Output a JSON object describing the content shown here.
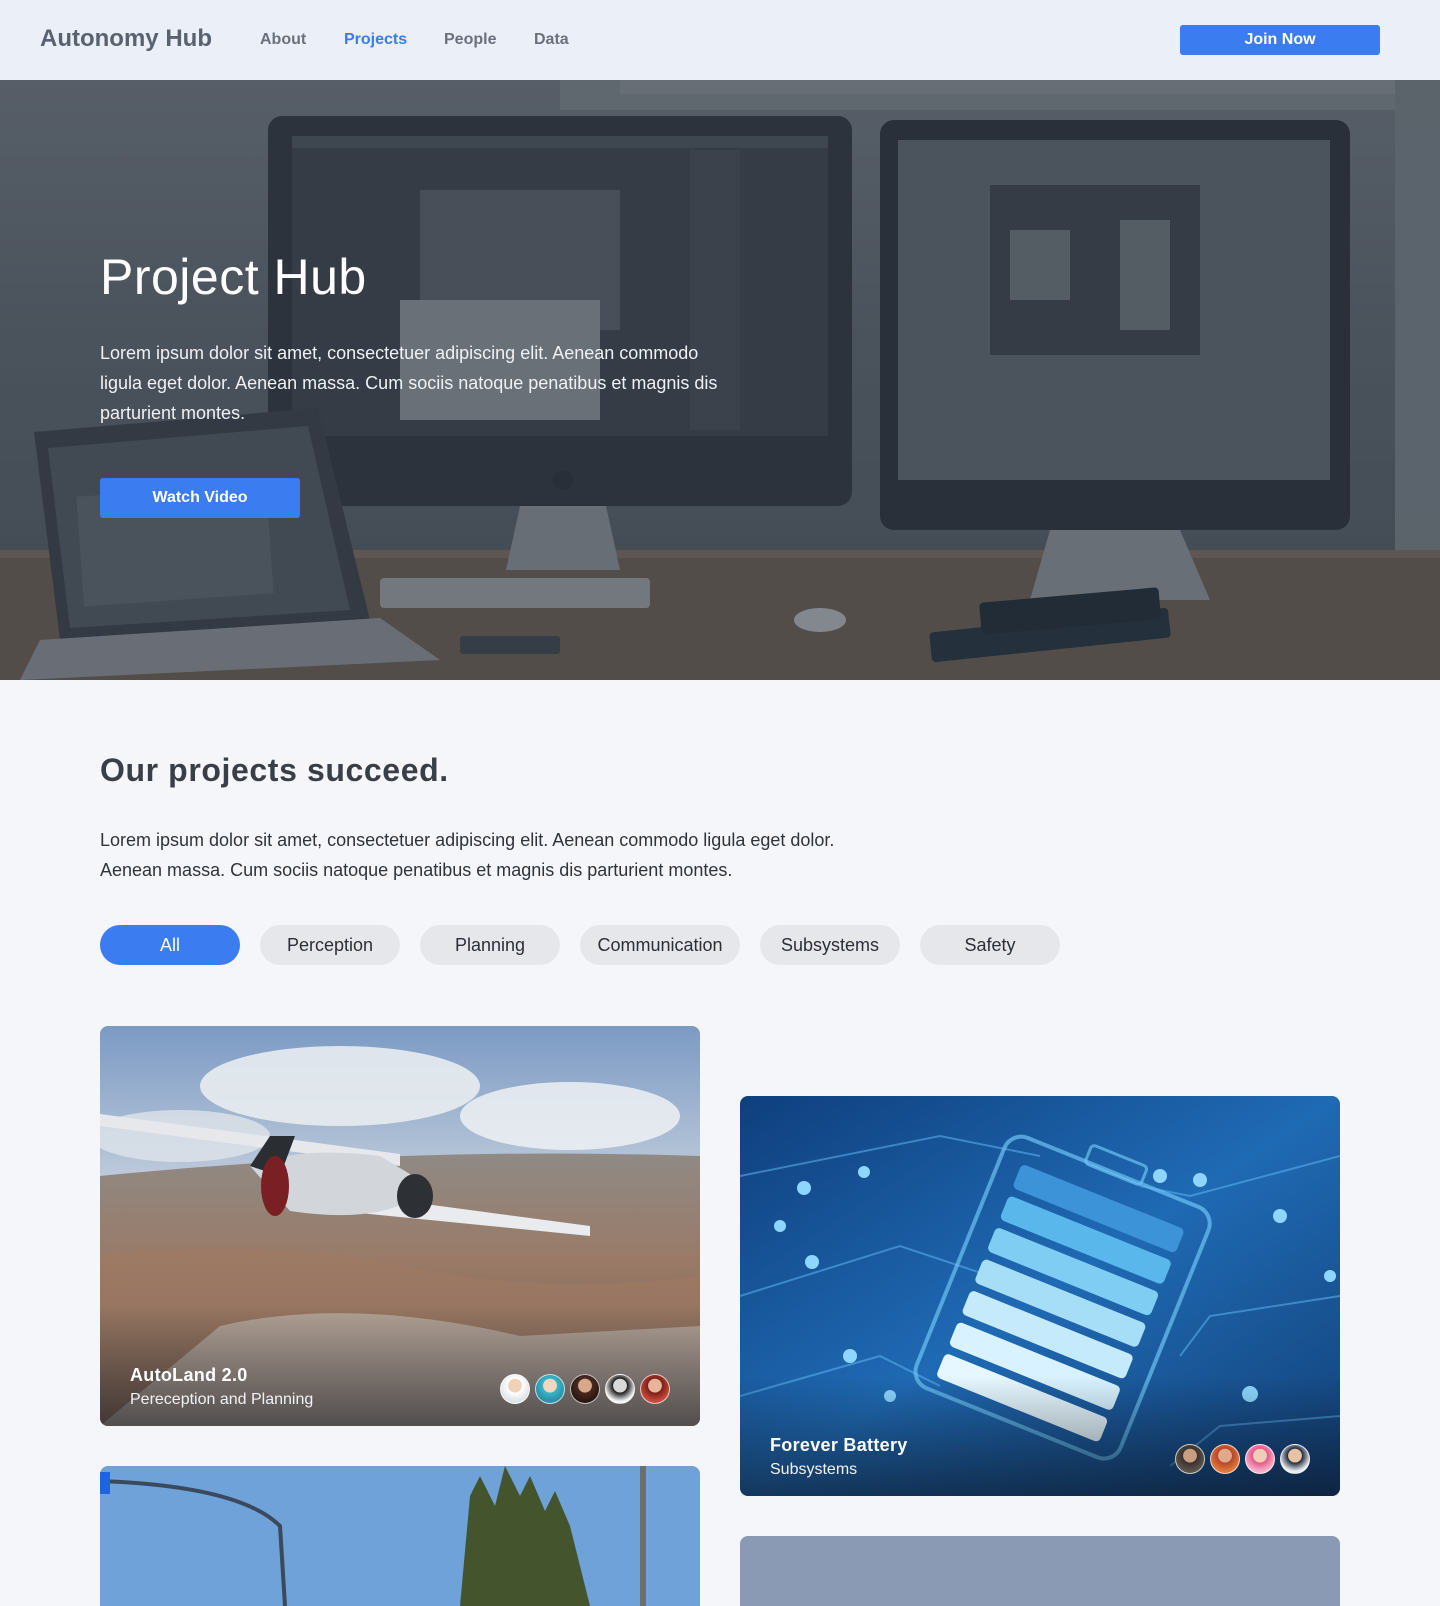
{
  "nav": {
    "brand": "Autonomy Hub",
    "links": [
      {
        "label": "About",
        "active": false
      },
      {
        "label": "Projects",
        "active": true
      },
      {
        "label": "People",
        "active": false
      },
      {
        "label": "Data",
        "active": false
      }
    ],
    "cta": "Join Now"
  },
  "hero": {
    "title": "Project Hub",
    "text": "Lorem ipsum dolor sit amet, consectetuer adipiscing elit. Aenean commodo ligula eget dolor. Aenean massa. Cum sociis natoque penatibus et magnis dis parturient montes.",
    "button": "Watch Video"
  },
  "section": {
    "title": "Our projects succeed.",
    "text": "Lorem ipsum dolor sit amet, consectetuer adipiscing elit. Aenean commodo ligula eget dolor. Aenean massa. Cum sociis natoque penatibus et magnis dis parturient montes."
  },
  "filters": [
    {
      "label": "All",
      "active": true
    },
    {
      "label": "Perception",
      "active": false
    },
    {
      "label": "Planning",
      "active": false
    },
    {
      "label": "Communication",
      "active": false
    },
    {
      "label": "Subsystems",
      "active": false
    },
    {
      "label": "Safety",
      "active": false
    }
  ],
  "projects": [
    {
      "title": "AutoLand 2.0",
      "subtitle": "Pereception and Planning",
      "member_count": 5
    },
    {
      "title": "Forever Battery",
      "subtitle": "Subsystems",
      "member_count": 4
    }
  ],
  "colors": {
    "accent": "#3b7cf0",
    "nav_bg": "#ebeff7",
    "page_bg": "#f5f6f9",
    "chip_bg": "#e6e7ea"
  }
}
